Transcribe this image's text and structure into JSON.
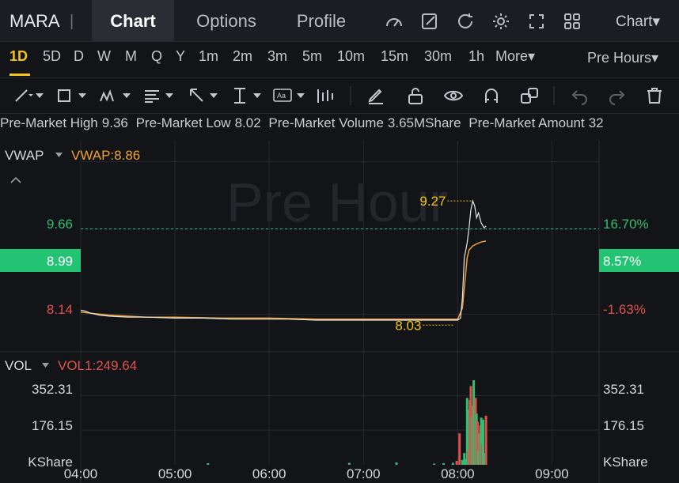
{
  "app": {
    "ticker": "MARA",
    "ticker_separator": "|",
    "tabs": [
      {
        "label": "Chart",
        "active": true
      },
      {
        "label": "Options",
        "active": false
      },
      {
        "label": "Profile",
        "active": false
      }
    ],
    "chart_menu_label": "Chart▾"
  },
  "periods": {
    "items": [
      "1D",
      "5D",
      "D",
      "W",
      "M",
      "Q",
      "Y",
      "1m",
      "2m",
      "3m",
      "5m",
      "10m",
      "15m",
      "30m",
      "1h",
      "More▾"
    ],
    "active": "1D",
    "session_selector": "Pre Hours▾"
  },
  "toolbar_icons": [
    "line-tool-icon",
    "rectangle-tool-icon",
    "pattern-tool-icon",
    "fibonacci-tool-icon",
    "arrow-tool-icon",
    "measure-tool-icon",
    "text-tool-icon",
    "indicator-tool-icon",
    "pencil-icon",
    "unlock-icon",
    "eye-icon",
    "magnet-icon",
    "multi-window-icon",
    "undo-icon",
    "redo-icon",
    "trash-icon"
  ],
  "info": {
    "items": [
      {
        "label": "Pre-Market High",
        "value": "9.36"
      },
      {
        "label": "Pre-Market Low",
        "value": "8.02"
      },
      {
        "label": "Pre-Market Volume",
        "value": "3.65MShare"
      },
      {
        "label": "Pre-Market Amount",
        "value": "32"
      }
    ]
  },
  "colors": {
    "background": "#131417",
    "accent": "#f2c318",
    "vwap": "#f0a030",
    "price_line": "#e6e6e6",
    "up": "#2fbf71",
    "down": "#e0514d",
    "current_price_bg": "#22c474"
  },
  "chart_data": [
    {
      "type": "line",
      "panel": "price",
      "watermark": "Pre Hour",
      "indicator": {
        "name": "VWAP",
        "label": "VWAP:8.86"
      },
      "collapse_icon": "chevron-up-icon",
      "left_axis": [
        "9.66",
        "8.99",
        "8.14"
      ],
      "right_axis": [
        "16.70%",
        "8.57%",
        "-1.63%"
      ],
      "current_price": "8.99",
      "current_pct": "8.57%",
      "high_marker": "9.27",
      "low_marker": "8.03",
      "ylim": [
        7.78,
        9.87
      ],
      "x_ticks": [
        "04:00",
        "05:00",
        "06:00",
        "07:00",
        "08:00",
        "09:00"
      ],
      "xlim": [
        4.0,
        9.5
      ],
      "price_series": {
        "x": [
          4.0,
          4.05,
          4.1,
          4.2,
          4.3,
          4.5,
          4.7,
          5.0,
          5.3,
          5.6,
          5.9,
          6.2,
          6.5,
          6.8,
          7.0,
          7.2,
          7.5,
          7.8,
          7.9,
          8.0,
          8.03,
          8.05,
          8.07,
          8.1,
          8.12,
          8.14,
          8.16,
          8.18,
          8.2,
          8.22,
          8.25,
          8.28,
          8.3
        ],
        "y": [
          8.18,
          8.17,
          8.15,
          8.13,
          8.12,
          8.11,
          8.11,
          8.1,
          8.1,
          8.09,
          8.09,
          8.09,
          8.08,
          8.08,
          8.08,
          8.08,
          8.08,
          8.08,
          8.08,
          8.08,
          8.1,
          8.3,
          8.7,
          8.85,
          9.0,
          9.18,
          9.27,
          9.22,
          9.1,
          9.15,
          9.05,
          9.0,
          9.02
        ]
      },
      "vwap_series": {
        "x": [
          4.0,
          4.3,
          4.7,
          5.0,
          5.5,
          6.0,
          6.5,
          7.0,
          7.5,
          7.8,
          8.0,
          8.05,
          8.08,
          8.1,
          8.12,
          8.16,
          8.2,
          8.25,
          8.3
        ],
        "y": [
          8.16,
          8.13,
          8.11,
          8.11,
          8.1,
          8.1,
          8.09,
          8.09,
          8.09,
          8.09,
          8.09,
          8.2,
          8.5,
          8.7,
          8.78,
          8.82,
          8.84,
          8.86,
          8.87
        ]
      }
    },
    {
      "type": "bar",
      "panel": "volume",
      "indicator": {
        "name": "VOL",
        "label": "VOL1:249.64"
      },
      "axis_labels": [
        "352.31",
        "176.15",
        "KShare"
      ],
      "ylim": [
        0,
        450
      ],
      "bars": {
        "x": [
          5.35,
          6.85,
          7.35,
          7.75,
          7.85,
          7.95,
          7.99,
          8.02,
          8.05,
          8.07,
          8.08,
          8.1,
          8.11,
          8.12,
          8.13,
          8.14,
          8.15,
          8.16,
          8.17,
          8.18,
          8.19,
          8.2,
          8.21,
          8.22,
          8.23,
          8.24,
          8.25,
          8.26,
          8.27,
          8.28,
          8.3
        ],
        "values": [
          8,
          10,
          12,
          6,
          8,
          10,
          20,
          160,
          25,
          60,
          30,
          340,
          70,
          280,
          330,
          400,
          245,
          300,
          430,
          130,
          340,
          260,
          220,
          70,
          160,
          200,
          240,
          100,
          230,
          60,
          250
        ],
        "up": [
          true,
          true,
          true,
          true,
          true,
          true,
          false,
          false,
          true,
          true,
          true,
          true,
          false,
          true,
          false,
          false,
          true,
          false,
          true,
          true,
          false,
          true,
          false,
          true,
          true,
          false,
          true,
          false,
          true,
          true,
          false
        ]
      }
    }
  ]
}
